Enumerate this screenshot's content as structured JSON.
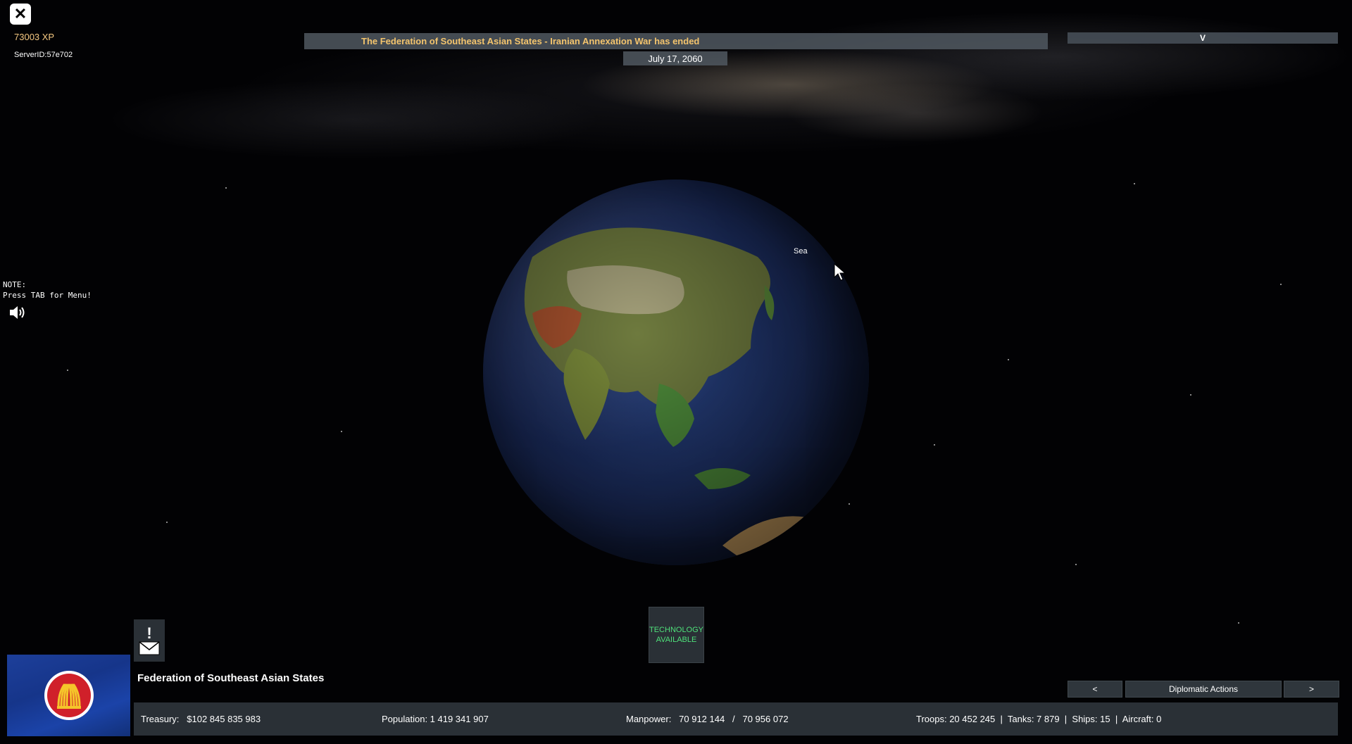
{
  "hud": {
    "close_label": "✕",
    "xp": "73003 XP",
    "server_id": "ServerID:57e702",
    "note_line1": "NOTE:",
    "note_line2": "Press TAB for Menu!"
  },
  "news": {
    "banner": "The Federation of Southeast Asian States - Iranian Annexation War has ended",
    "toggle_label": "V",
    "date": "July 17, 2060"
  },
  "map": {
    "hover_label": "Sea"
  },
  "technology": {
    "line1": "TECHNOLOGY",
    "line2": "AVAILABLE"
  },
  "messages": {
    "alert": "!"
  },
  "country": {
    "name": "Federation of Southeast Asian States",
    "flag_color": "#1b3f9e"
  },
  "nav": {
    "prev": "<",
    "diplomatic": "Diplomatic Actions",
    "next": ">"
  },
  "stats": {
    "treasury": "Treasury:   $102 845 835 983",
    "population": "Population: 1 419 341 907",
    "manpower": "Manpower:   70 912 144   /   70 956 072",
    "military": "Troops: 20 452 245  |  Tanks: 7 879  |  Ships: 15  |  Aircraft: 0"
  }
}
